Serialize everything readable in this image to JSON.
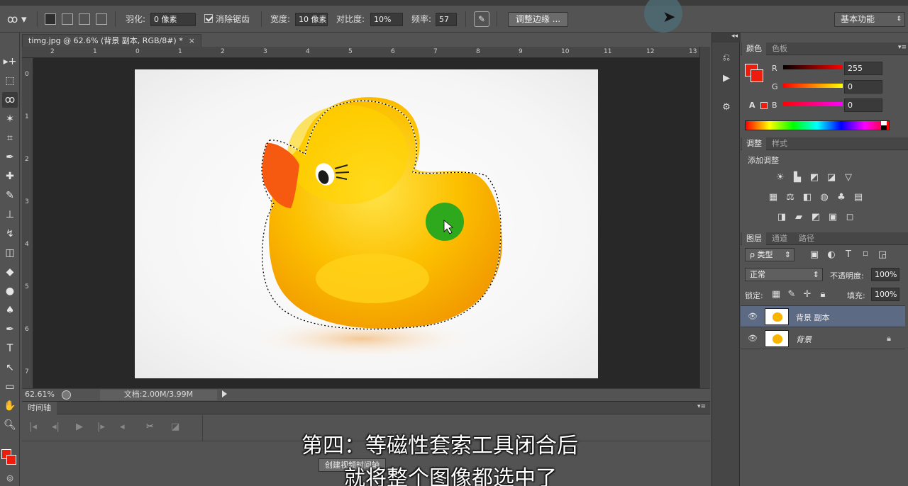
{
  "options_bar": {
    "feather_label": "羽化:",
    "feather_value": "0 像素",
    "antialias_label": "消除锯齿",
    "width_label": "宽度:",
    "width_value": "10 像素",
    "contrast_label": "对比度:",
    "contrast_value": "10%",
    "frequency_label": "频率:",
    "frequency_value": "57",
    "refine_edge_label": "调整边缘 ...",
    "workspace_label": "基本功能"
  },
  "document": {
    "tab_title": "timg.jpg @ 62.6% (背景 副本, RGB/8#) *",
    "tab_close": "×",
    "ruler_top_ticks": [
      "2",
      "1",
      "0",
      "1",
      "2",
      "3",
      "4",
      "5",
      "6",
      "7",
      "8",
      "9",
      "10",
      "11",
      "12",
      "13"
    ],
    "ruler_left_ticks": [
      "0",
      "1",
      "2",
      "3",
      "4",
      "5",
      "6",
      "7"
    ]
  },
  "status_bar": {
    "zoom": "62.61%",
    "doc_size": "文档:2.00M/3.99M"
  },
  "timeline": {
    "title": "时间轴",
    "create_label": "创建视频时间轴"
  },
  "subtitles": {
    "line1": "第四：等磁性套索工具闭合后",
    "line2": "就将整个图像都选中了"
  },
  "color_panel": {
    "tabs": [
      "颜色",
      "色板"
    ],
    "r_label": "R",
    "g_label": "G",
    "b_label": "B",
    "r_value": "255",
    "g_value": "0",
    "b_value": "0",
    "foreground_color": "#ee1c0c"
  },
  "adjustments_panel": {
    "tabs": [
      "调整",
      "样式"
    ],
    "add_label": "添加调整"
  },
  "layers_panel": {
    "tabs": [
      "图层",
      "通道",
      "路径"
    ],
    "filter_label": "ρ 类型",
    "blend_mode": "正常",
    "opacity_label": "不透明度:",
    "opacity_value": "100%",
    "lock_label": "锁定:",
    "fill_label": "填充:",
    "fill_value": "100%",
    "layers": [
      {
        "name": "背景 副本",
        "active": true
      },
      {
        "name": "背景",
        "active": false
      }
    ]
  },
  "colors": {
    "selection_green": "#2ea81c",
    "duck_yellow": "#fcc000",
    "beak_orange": "#f55a10",
    "active_layer": "#5d6a84"
  }
}
